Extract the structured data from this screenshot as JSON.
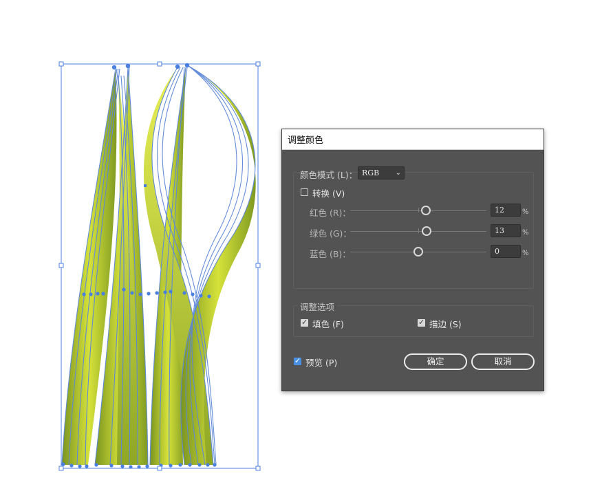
{
  "dialog": {
    "title": "调整颜色",
    "color_mode": {
      "label": "颜色模式 (L)：",
      "value": "RGB"
    },
    "convert": {
      "label": "转换 (V)",
      "checked": false
    },
    "channels": [
      {
        "label": "红色 (R)：",
        "value": "12",
        "unit": "%",
        "level": 0.55
      },
      {
        "label": "绿色 (G)：",
        "value": "13",
        "unit": "%",
        "level": 0.56
      },
      {
        "label": "蓝色 (B)：",
        "value": "0",
        "unit": "%",
        "level": 0.5
      }
    ],
    "options": {
      "legend": "调整选项",
      "fill": {
        "label": "填色 (F)",
        "checked": true
      },
      "stroke": {
        "label": "描边 (S)",
        "checked": true
      }
    },
    "preview": {
      "label": "预览 (P)",
      "checked": true
    },
    "ok_label": "确定",
    "cancel_label": "取消"
  },
  "colors": {
    "dialog_bg": "#535353",
    "selection": "#4a7fe0",
    "leaf_light": "#d4e03c",
    "leaf_dark": "#7e9820",
    "accent_check": "#4a90e2"
  },
  "icons": [
    "checkbox-icon",
    "chevron-down-icon",
    "check-icon",
    "anchor-point-icon",
    "bounding-handle-icon"
  ]
}
